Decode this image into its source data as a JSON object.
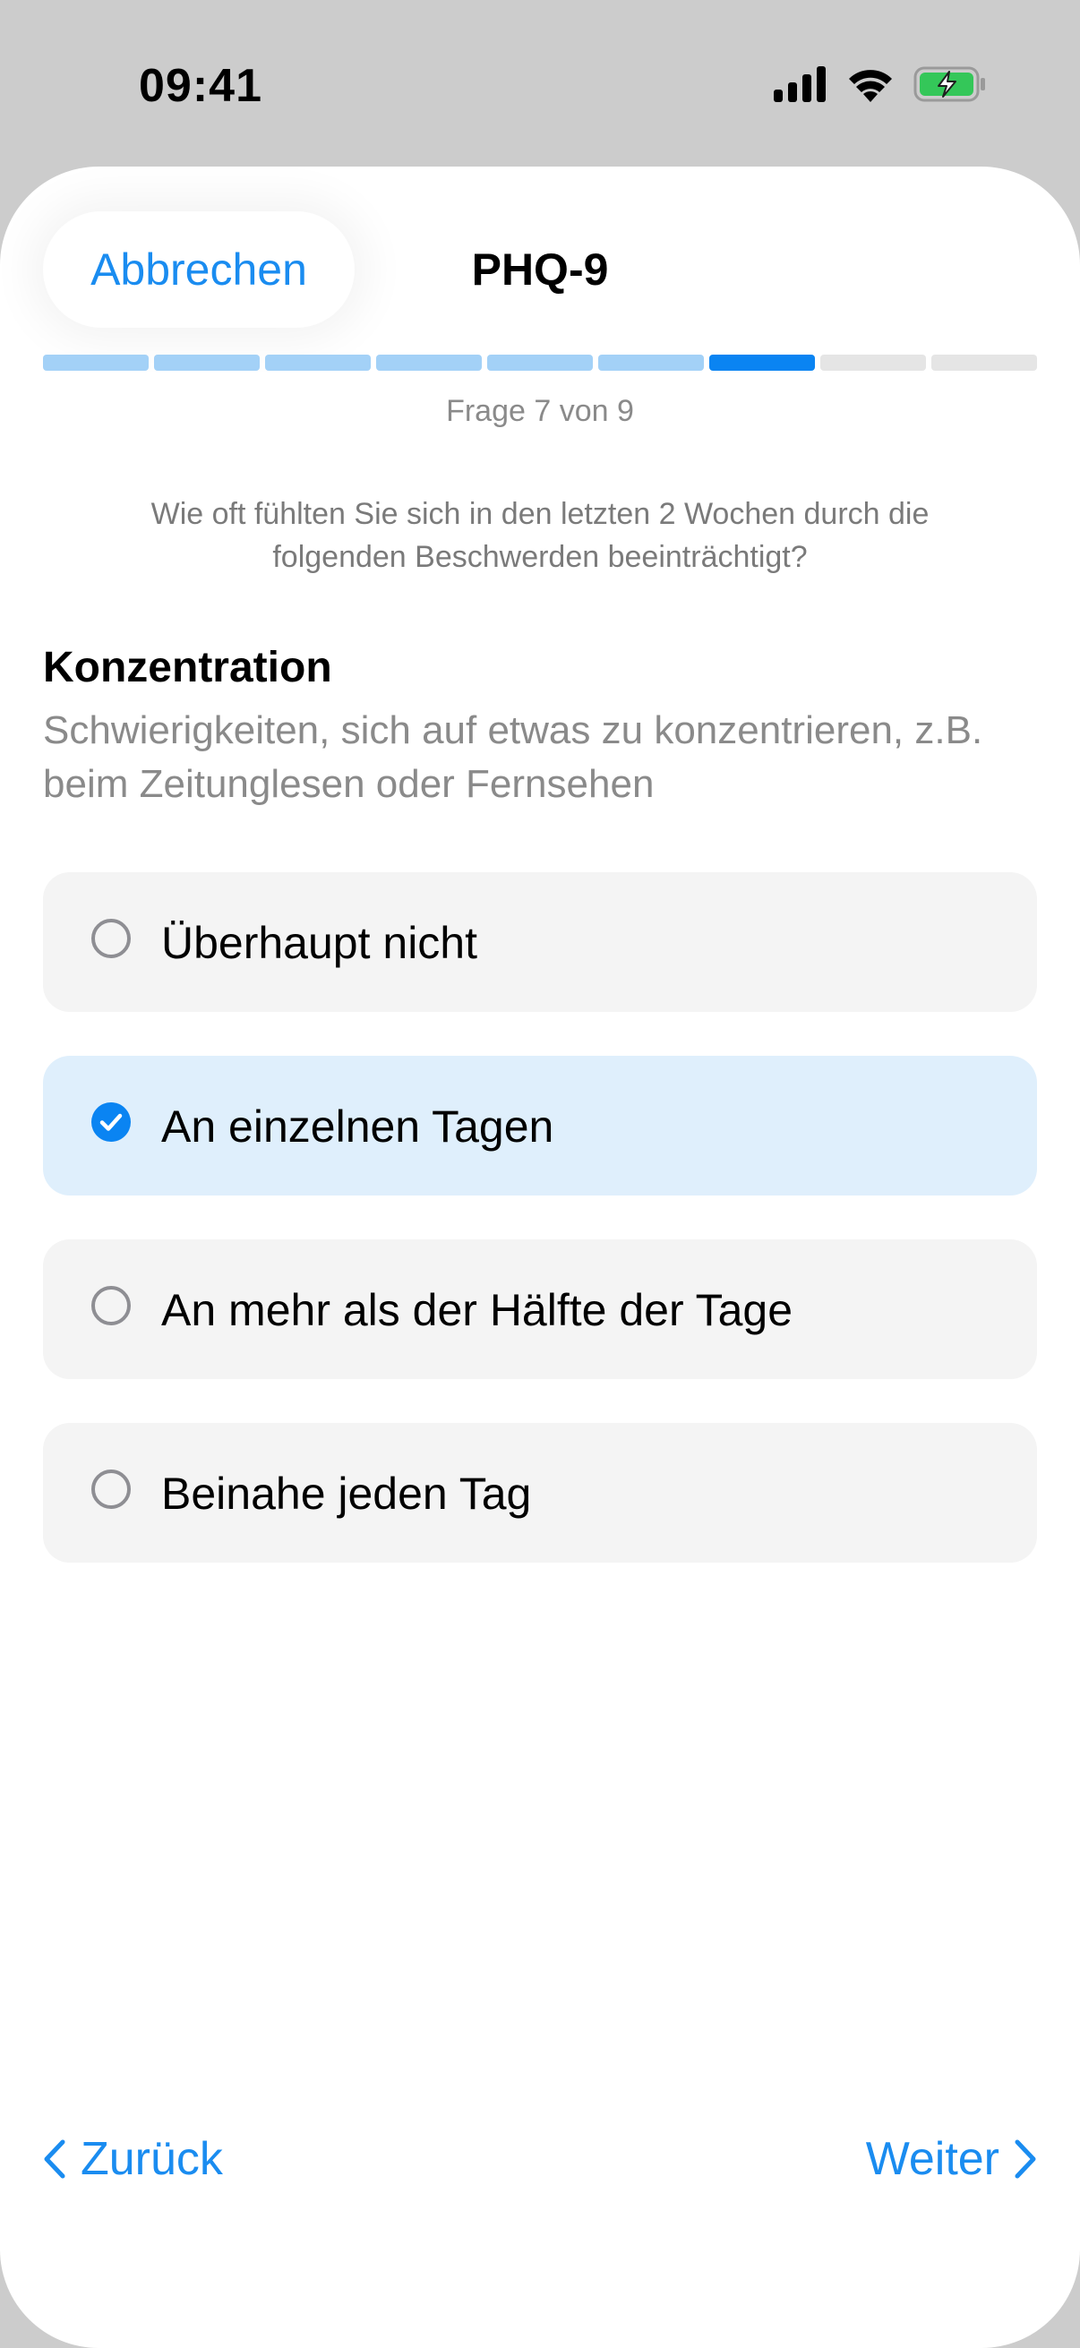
{
  "status_bar": {
    "time": "09:41",
    "icons": [
      "cellular-signal-icon",
      "wifi-icon",
      "battery-charging-icon"
    ],
    "battery_color": "#34c759"
  },
  "header": {
    "cancel_label": "Abbrechen",
    "title": "PHQ-9"
  },
  "progress": {
    "current": 7,
    "total": 9,
    "label": "Frage 7 von 9"
  },
  "instruction": "Wie oft fühlten Sie sich in den letzten 2 Wochen durch die folgenden Beschwerden beeinträchtigt?",
  "question": {
    "title": "Konzentration",
    "description": "Schwierigkeiten, sich auf etwas zu konzentrieren, z.B. beim Zeitunglesen oder Fernsehen"
  },
  "options": [
    {
      "label": "Überhaupt nicht",
      "selected": false
    },
    {
      "label": "An einzelnen Tagen",
      "selected": true
    },
    {
      "label": "An mehr als der Hälfte der Tage",
      "selected": false
    },
    {
      "label": "Beinahe jeden Tag",
      "selected": false
    }
  ],
  "footer": {
    "back_label": "Zurück",
    "back_icon": "chevron-left-icon",
    "next_label": "Weiter",
    "next_icon": "chevron-right-icon"
  },
  "colors": {
    "accent": "#0a84f2",
    "link": "#1a8cf0",
    "progress_done": "#a3d1f7",
    "progress_todo": "#e5e5e5",
    "selected_bg": "#dfeffc",
    "option_bg": "#f4f4f4"
  }
}
